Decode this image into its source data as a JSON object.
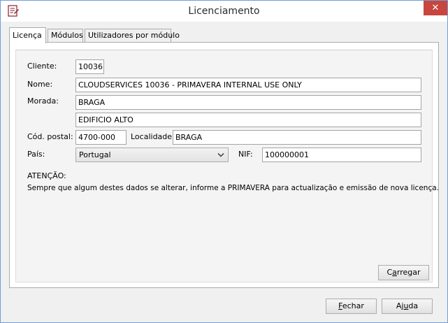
{
  "window": {
    "title": "Licenciamento",
    "close_glyph": "✕"
  },
  "tabs": [
    {
      "label": "Licença"
    },
    {
      "label": "Módulos"
    },
    {
      "label": "Utilizadores por módulo"
    }
  ],
  "form": {
    "cliente_label": "Cliente:",
    "cliente_value": "10036",
    "nome_label": "Nome:",
    "nome_value": "CLOUDSERVICES 10036 - PRIMAVERA INTERNAL USE ONLY",
    "morada_label": "Morada:",
    "morada_line1": "BRAGA",
    "morada_line2": "EDIFICIO ALTO",
    "cod_postal_label": "Cód. postal:",
    "cod_postal_value": "4700-000",
    "localidade_label": "Localidade:",
    "localidade_value": "BRAGA",
    "pais_label": "País:",
    "pais_value": "Portugal",
    "nif_label": "NIF:",
    "nif_value": "100000001"
  },
  "notice": {
    "heading": "ATENÇÃO:",
    "text": "Sempre que algum destes dados se alterar, informe a PRIMAVERA para actualização e emissão de nova licença."
  },
  "buttons": {
    "carregar_pre": "C",
    "carregar_key": "a",
    "carregar_post": "rregar",
    "fechar_key": "F",
    "fechar_post": "echar",
    "ajuda_pre": "Aj",
    "ajuda_key": "u",
    "ajuda_post": "da"
  },
  "icons": {
    "app": "license-document-icon",
    "close": "close-icon",
    "dropdown": "chevron-down-icon"
  }
}
